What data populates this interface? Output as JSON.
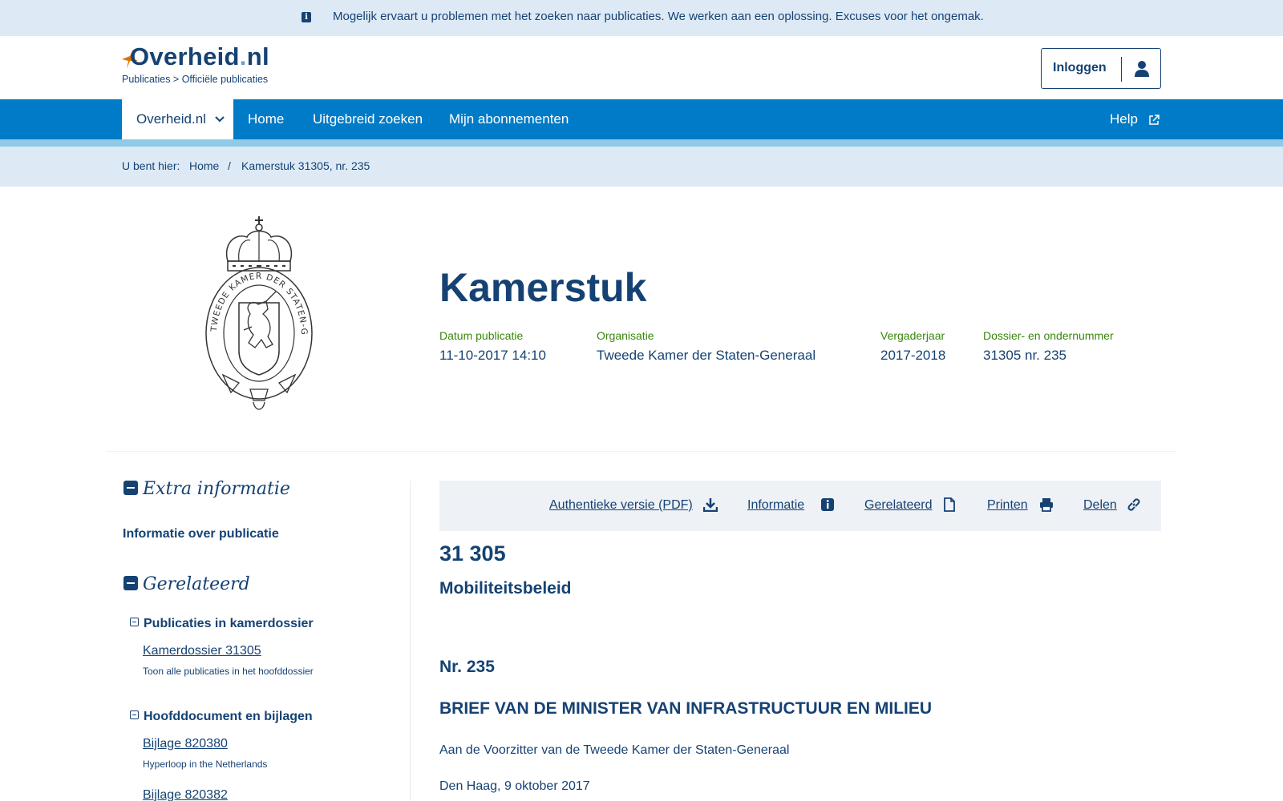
{
  "notice": {
    "text": "Mogelijk ervaart u problemen met het zoeken naar publicaties. We werken aan een oplossing. Excuses voor het ongemak.",
    "icon": "info-icon"
  },
  "header": {
    "logo_main": "Overheid",
    "logo_dot": ".",
    "logo_tld": "nl",
    "sub": "Publicaties > Officiële publicaties",
    "login_label": "Inloggen",
    "login_icon": "user-icon"
  },
  "nav": {
    "active_label": "Overheid.nl",
    "items": [
      "Home",
      "Uitgebreid zoeken",
      "Mijn abonnementen"
    ],
    "help_label": "Help"
  },
  "breadcrumb": {
    "prefix": "U bent hier:",
    "home": "Home",
    "separator": "/",
    "current": "Kamerstuk 31305, nr. 235"
  },
  "hero": {
    "title": "Kamerstuk",
    "meta": [
      {
        "label": "Datum publicatie",
        "value": "11-10-2017 14:10"
      },
      {
        "label": "Organisatie",
        "value": "Tweede Kamer der Staten-Generaal"
      },
      {
        "label": "Vergaderjaar",
        "value": "2017-2018"
      },
      {
        "label": "Dossier- en ondernummer",
        "value": "31305 nr. 235"
      }
    ],
    "seal_text": "TWEEDE KAMER DER STATEN-GENERAAL"
  },
  "sidebar": {
    "extra_head": "Extra informatie",
    "extra_link": "Informatie over publicatie",
    "related_head": "Gerelateerd",
    "groups": [
      {
        "title": "Publicaties in kamerdossier",
        "links": [
          {
            "label": "Kamerdossier 31305",
            "note": "Toon alle publicaties in het hoofddossier"
          }
        ]
      },
      {
        "title": "Hoofddocument en bijlagen",
        "links": [
          {
            "label": "Bijlage 820380",
            "note": "Hyperloop in the Netherlands"
          },
          {
            "label": "Bijlage 820382",
            "note": ""
          }
        ]
      }
    ]
  },
  "toolbar": {
    "items": [
      {
        "label": "Authentieke versie (PDF)",
        "icon": "download-icon"
      },
      {
        "label": "Informatie",
        "icon": "info-icon"
      },
      {
        "label": "Gerelateerd",
        "icon": "document-icon"
      },
      {
        "label": "Printen",
        "icon": "printer-icon"
      },
      {
        "label": "Delen",
        "icon": "link-icon"
      }
    ]
  },
  "document": {
    "number": "31 305",
    "subject": "Mobiliteitsbeleid",
    "nr": "Nr. 235",
    "brief": "BRIEF VAN DE MINISTER VAN INFRASTRUCTUUR EN MILIEU",
    "addressee": "Aan de Voorzitter van de Tweede Kamer der Staten-Generaal",
    "place_date": "Den Haag, 9 oktober 2017"
  },
  "colors": {
    "brand_dark": "#154273",
    "nav_blue": "#007bc7",
    "light_blue": "#ddeaf5",
    "meta_green": "#39870c",
    "logo_orange": "#e17000"
  }
}
